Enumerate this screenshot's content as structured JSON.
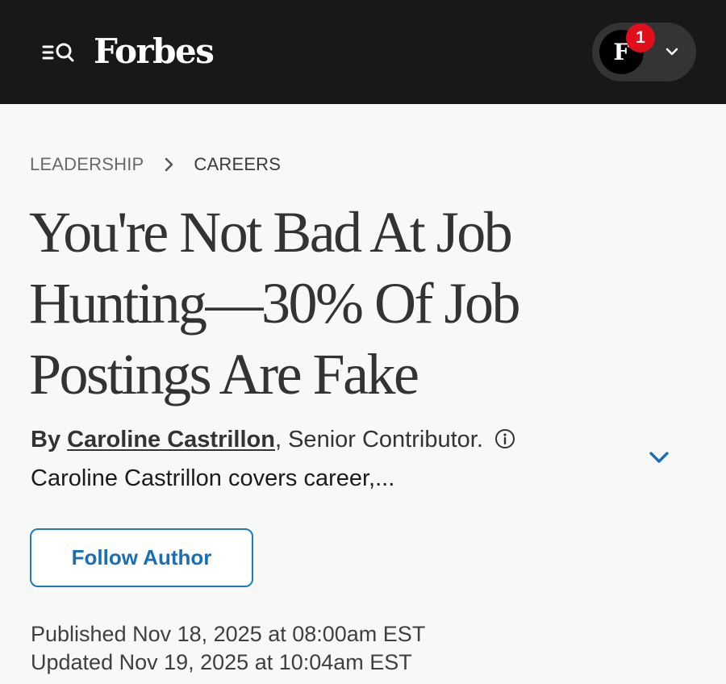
{
  "header": {
    "logo": "Forbes",
    "menu_icon": "search-menu-icon",
    "account": {
      "avatar_letter": "F",
      "notification_count": "1",
      "dropdown_icon": "chevron-down-icon"
    }
  },
  "breadcrumb": {
    "items": [
      "LEADERSHIP",
      "CAREERS"
    ],
    "separator_icon": "chevron-right-icon"
  },
  "article": {
    "headline": "You're Not Bad At Job Hunting—30% Of Job Postings Are Fake",
    "byline": {
      "by": "By",
      "author": "Caroline Castrillon",
      "comma": ",",
      "role": "Senior Contributor.",
      "info_icon": "info-icon",
      "bio": "Caroline Castrillon covers career,...",
      "expand_icon": "chevron-down-icon"
    },
    "follow_label": "Follow Author",
    "published": "Published Nov 18, 2025 at 08:00am EST",
    "updated": "Updated Nov 19, 2025 at 10:04am EST"
  },
  "colors": {
    "header_bg": "#181818",
    "badge": "#e10f1b",
    "accent_blue": "#1a6fb4",
    "page_bg": "#f8f8f8"
  }
}
